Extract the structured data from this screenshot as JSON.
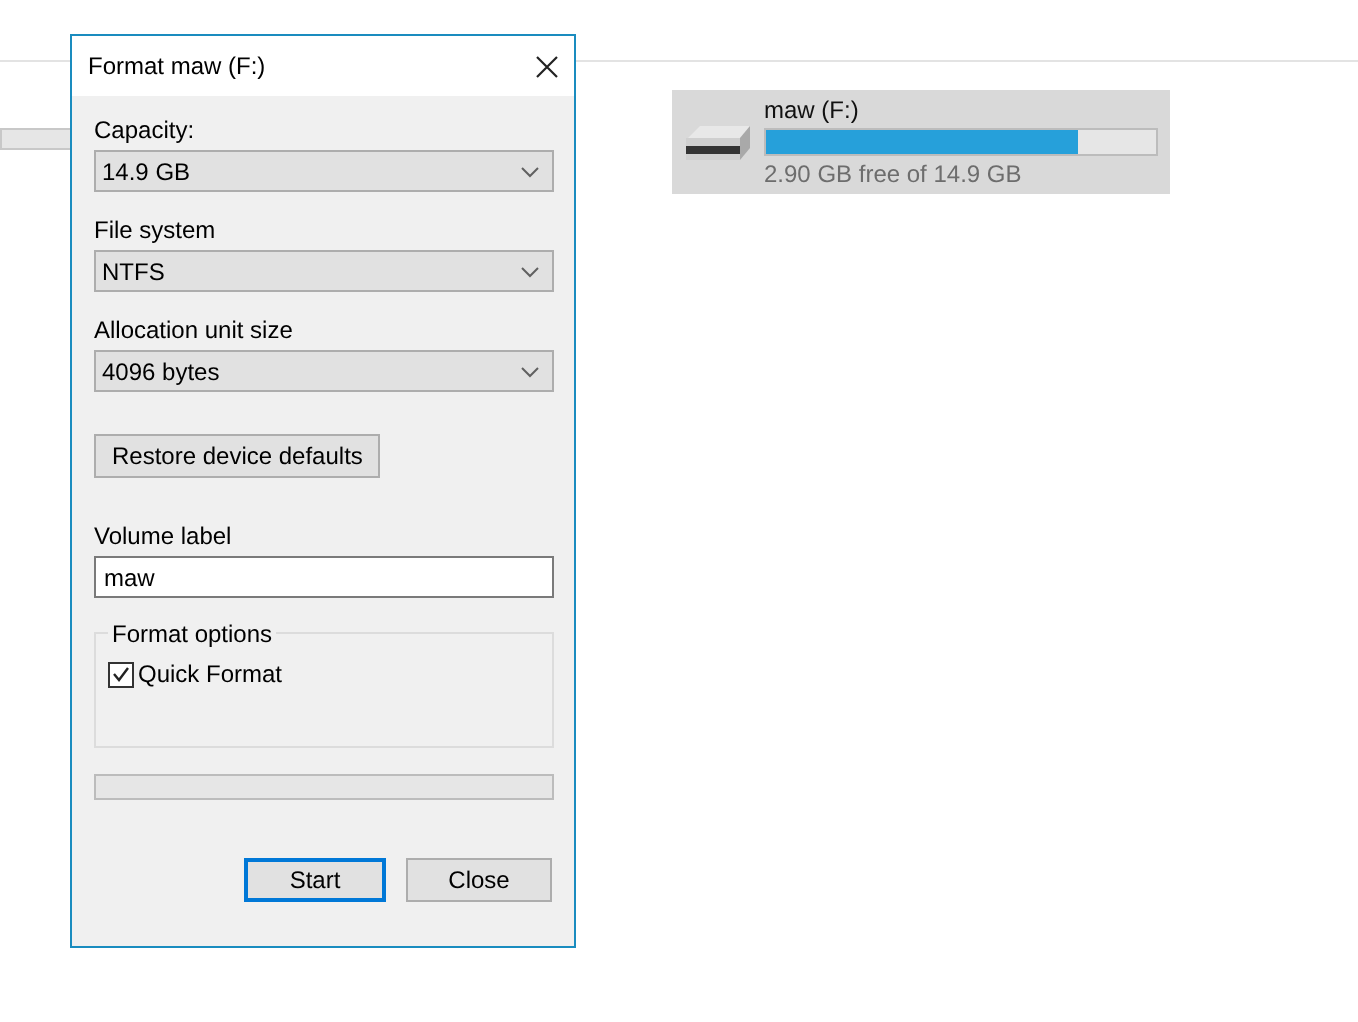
{
  "window": {
    "title": "Format maw (F:)"
  },
  "fields": [
    {
      "label": "Capacity:",
      "value": "14.9 GB"
    },
    {
      "label": "File system",
      "value": "NTFS"
    },
    {
      "label": "Allocation unit size",
      "value": "4096 bytes"
    }
  ],
  "restore_button": "Restore device defaults",
  "volume_label": {
    "label": "Volume label",
    "value": "maw"
  },
  "format_options": {
    "title": "Format options",
    "options": [
      {
        "label": "Quick Format",
        "checked": true
      }
    ]
  },
  "progress": {
    "level": 0
  },
  "buttons": [
    {
      "label": "Start",
      "default": true
    },
    {
      "label": "Close",
      "default": false
    }
  ],
  "drive": {
    "name": "maw (F:)",
    "level": 0.8,
    "free_text": "2.90 GB free of 14.9 GB"
  }
}
